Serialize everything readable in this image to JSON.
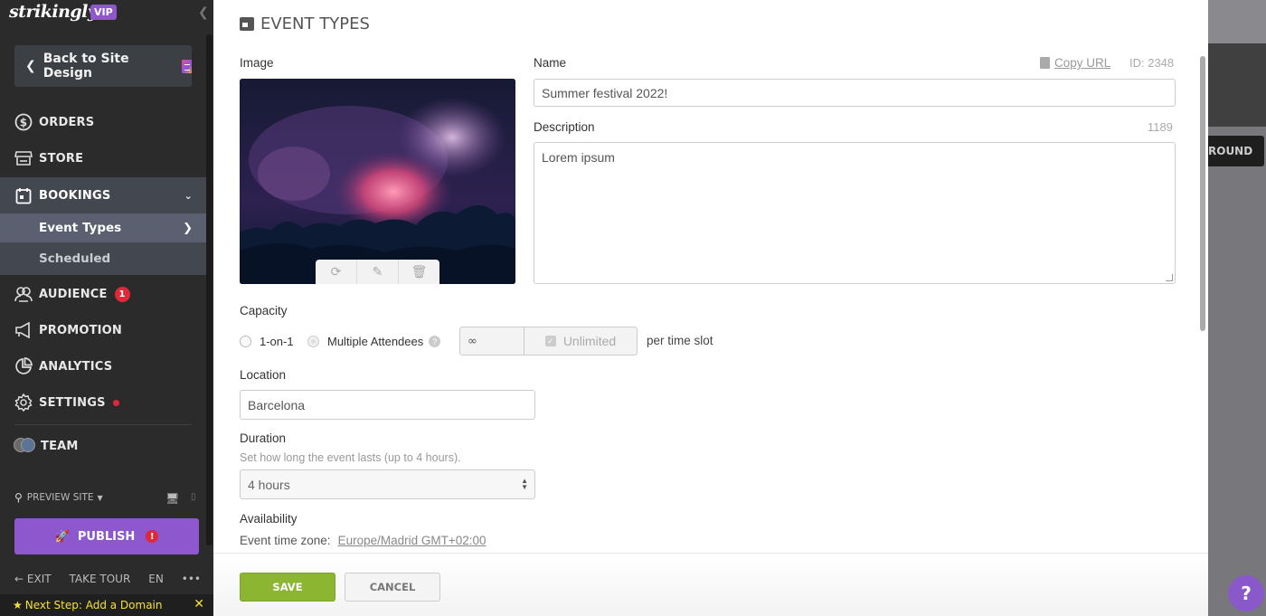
{
  "sidebar": {
    "logo": "strikingly",
    "vip_badge": "VIP",
    "back_button": "Back to Site Design",
    "nav": [
      {
        "label": "ORDERS",
        "icon": "dollar-circle-icon"
      },
      {
        "label": "STORE",
        "icon": "storefront-icon"
      },
      {
        "label": "BOOKINGS",
        "icon": "calendar-icon",
        "expanded": true
      },
      {
        "label": "AUDIENCE",
        "icon": "users-icon",
        "badge": "1"
      },
      {
        "label": "PROMOTION",
        "icon": "megaphone-icon"
      },
      {
        "label": "ANALYTICS",
        "icon": "pie-chart-icon"
      },
      {
        "label": "SETTINGS",
        "icon": "gear-icon",
        "dot": true
      },
      {
        "label": "TEAM",
        "icon": "team-avatars-icon"
      }
    ],
    "bookings_sub": [
      {
        "label": "Event Types",
        "selected": true
      },
      {
        "label": "Scheduled",
        "selected": false
      }
    ],
    "preview_site": "PREVIEW SITE",
    "publish": "PUBLISH",
    "bottom_links": {
      "exit": "EXIT",
      "tour": "TAKE TOUR",
      "lang": "EN",
      "more": "•••"
    },
    "next_step": "Next Step: Add a Domain"
  },
  "modal": {
    "title": "EVENT TYPES",
    "image_label": "Image",
    "name_label": "Name",
    "copy_url": "Copy URL",
    "id_text": "ID: 2348",
    "name_value": "Summer festival 2022!",
    "description_label": "Description",
    "description_count": "1189",
    "description_value": "Lorem ipsum",
    "capacity_label": "Capacity",
    "capacity_options": [
      {
        "label": "1-on-1",
        "selected": false
      },
      {
        "label": "Multiple Attendees",
        "selected": true
      }
    ],
    "capacity_value": "∞",
    "unlimited_label": "Unlimited",
    "unlimited_checked": true,
    "per_slot": "per time slot",
    "location_label": "Location",
    "location_value": "Barcelona",
    "duration_label": "Duration",
    "duration_hint": "Set how long the event lasts (up to 4 hours).",
    "duration_value": "4 hours",
    "availability_label": "Availability",
    "timezone_label": "Event time zone:",
    "timezone_value": "Europe/Madrid GMT+02:00",
    "save": "SAVE",
    "cancel": "CANCEL"
  },
  "background": {
    "button_fragment": "ROUND",
    "help": "?"
  },
  "colors": {
    "accent_purple": "#8d58cd",
    "save_green": "#8cb532",
    "alert_red": "#e0283a",
    "next_step_yellow": "#f4e03a"
  }
}
